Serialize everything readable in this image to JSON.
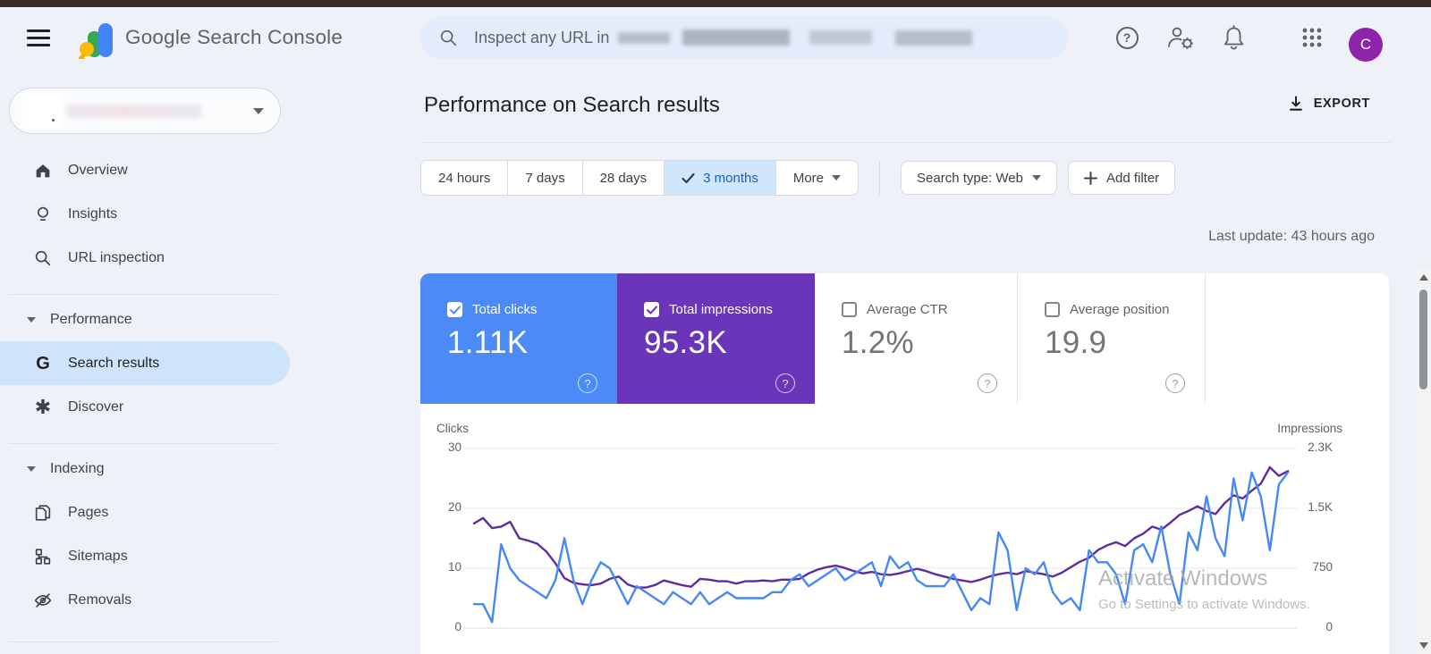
{
  "topbar": {
    "product_name": "Google Search Console",
    "search_text": "Inspect any URL in",
    "help_glyph": "?",
    "avatar_letter": "C"
  },
  "sidebar": {
    "items_top": [
      {
        "label": "Overview"
      },
      {
        "label": "Insights"
      },
      {
        "label": "URL inspection"
      }
    ],
    "sections": [
      {
        "label": "Performance",
        "items": [
          {
            "label": "Search results",
            "icon_letter": "G",
            "selected": true
          },
          {
            "label": "Discover",
            "icon_glyph": "✱"
          }
        ]
      },
      {
        "label": "Indexing",
        "items": [
          {
            "label": "Pages"
          },
          {
            "label": "Sitemaps"
          },
          {
            "label": "Removals"
          }
        ]
      }
    ]
  },
  "header": {
    "title": "Performance on Search results",
    "export_label": "EXPORT"
  },
  "filters": {
    "time_ranges": [
      "24 hours",
      "7 days",
      "28 days"
    ],
    "selected_time_range": "3 months",
    "more_label": "More",
    "search_type": "Search type: Web",
    "add_filter": "Add filter"
  },
  "status": {
    "last_update": "Last update: 43 hours ago"
  },
  "cards": [
    {
      "label": "Total clicks",
      "value": "1.11K",
      "checked": true,
      "color": "#4c8bf5"
    },
    {
      "label": "Total impressions",
      "value": "95.3K",
      "checked": true,
      "color": "#6a35b8"
    },
    {
      "label": "Average CTR",
      "value": "1.2%",
      "checked": false,
      "color": "#ffffff"
    },
    {
      "label": "Average position",
      "value": "19.9",
      "checked": false,
      "color": "#ffffff"
    }
  ],
  "watermark": {
    "line1": "Activate Windows",
    "line2": "Go to Settings to activate Windows."
  },
  "chart_data": {
    "type": "line",
    "grid": true,
    "legend_position": "none",
    "x_points": 91,
    "left_axis": {
      "label": "Clicks",
      "range": [
        0,
        30
      ],
      "ticks": [
        "30",
        "20",
        "10",
        "0"
      ]
    },
    "right_axis": {
      "label": "Impressions",
      "range": [
        0,
        2300
      ],
      "ticks": [
        "2.3K",
        "1.5K",
        "750",
        "0"
      ]
    },
    "series": [
      {
        "name": "Clicks",
        "axis": "left",
        "color": "#4788f4",
        "values": [
          4,
          4,
          1,
          14,
          10,
          8,
          7,
          6,
          5,
          8,
          15,
          8,
          4,
          8,
          11,
          10,
          7,
          4,
          7,
          6,
          5,
          4,
          6,
          5,
          4,
          6,
          4,
          5,
          6,
          5,
          5,
          5,
          5,
          6,
          6,
          8,
          9,
          7,
          8,
          9,
          10,
          8,
          9,
          10,
          11,
          7,
          12,
          10,
          11,
          8,
          7,
          7,
          7,
          9,
          6,
          3,
          5,
          4,
          16,
          13,
          3,
          10,
          9,
          11,
          6,
          4,
          5,
          3,
          13,
          11,
          11,
          9,
          4,
          13,
          14,
          11,
          17,
          9,
          4,
          16,
          13,
          22,
          15,
          12,
          25,
          18,
          26,
          22,
          13,
          24,
          26
        ]
      },
      {
        "name": "Impressions",
        "axis": "right",
        "color": "#5e2ca2",
        "values": [
          1340,
          1410,
          1280,
          1300,
          1360,
          1150,
          1120,
          1080,
          980,
          830,
          640,
          580,
          560,
          550,
          570,
          630,
          660,
          560,
          520,
          520,
          550,
          610,
          580,
          550,
          530,
          630,
          620,
          600,
          600,
          570,
          600,
          600,
          610,
          600,
          620,
          620,
          630,
          700,
          750,
          780,
          800,
          770,
          730,
          700,
          720,
          690,
          680,
          700,
          730,
          760,
          730,
          690,
          660,
          630,
          610,
          590,
          620,
          660,
          690,
          710,
          690,
          730,
          710,
          690,
          660,
          710,
          780,
          850,
          900,
          1000,
          1060,
          1100,
          1050,
          1150,
          1210,
          1300,
          1260,
          1350,
          1450,
          1500,
          1560,
          1500,
          1460,
          1600,
          1700,
          1660,
          1760,
          1850,
          2060,
          1950,
          2010
        ]
      }
    ]
  }
}
